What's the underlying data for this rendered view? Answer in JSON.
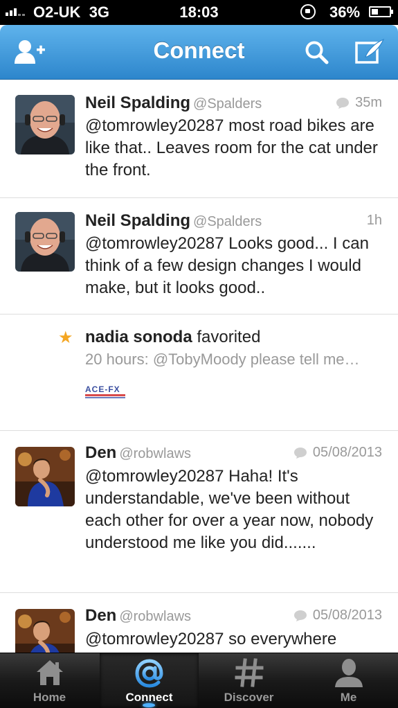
{
  "status_bar": {
    "carrier": "O2-UK",
    "network": "3G",
    "time": "18:03",
    "battery_percent": "36%",
    "battery_level": 0.36,
    "icons": [
      "signal-icon",
      "rotation-lock-icon",
      "battery-icon"
    ]
  },
  "nav": {
    "title": "Connect",
    "left_icon": "add-user-icon",
    "right_icons": [
      "search-icon",
      "compose-icon"
    ],
    "accent_color": "#3b95d9"
  },
  "timeline": [
    {
      "type": "tweet",
      "name": "Neil Spalding",
      "handle": "@Spalders",
      "time": "35m",
      "has_reply_icon": true,
      "text": "@tomrowley20287 most road bikes are like that.. Leaves room for the cat under the front."
    },
    {
      "type": "tweet",
      "name": "Neil Spalding",
      "handle": "@Spalders",
      "time": "1h",
      "has_reply_icon": false,
      "text": "@tomrowley20287 Looks good... I can think of a few design changes I would make, but it looks good.."
    },
    {
      "type": "favorite",
      "user": "nadia sonoda",
      "action": "favorited",
      "detail": "20 hours: @TobyMoody please tell me…",
      "media_logo": "ACE-FX"
    },
    {
      "type": "tweet",
      "name": "Den",
      "handle": "@robwlaws",
      "time": "05/08/2013",
      "has_reply_icon": true,
      "text": "@tomrowley20287 Haha! It's understandable, we've been without each other for over a year now, nobody understood me like you did......."
    },
    {
      "type": "tweet",
      "name": "Den",
      "handle": "@robwlaws",
      "time": "05/08/2013",
      "has_reply_icon": true,
      "text": "@tomrowley20287 so everywhere"
    }
  ],
  "tabs": [
    {
      "label": "Home",
      "icon": "home-icon",
      "active": false
    },
    {
      "label": "Connect",
      "icon": "at-icon",
      "active": true
    },
    {
      "label": "Discover",
      "icon": "hashtag-icon",
      "active": false
    },
    {
      "label": "Me",
      "icon": "person-icon",
      "active": false
    }
  ],
  "colors": {
    "favorite_star": "#f4a623",
    "secondary_text": "#999999",
    "active_tab_glow": "#4fb0ff"
  }
}
